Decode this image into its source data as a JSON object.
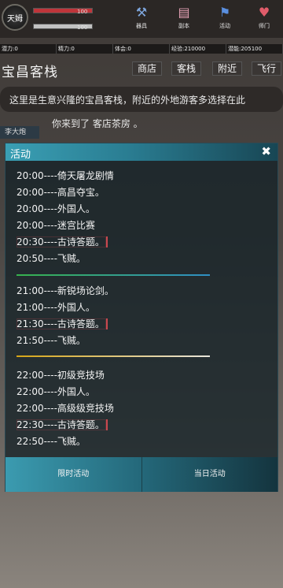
{
  "player": {
    "name": "天姆",
    "hp": "100",
    "mp": "100"
  },
  "nav": [
    {
      "icon": "hammer-anvil-icon",
      "label": "器具"
    },
    {
      "icon": "scroll-icon",
      "label": "副本"
    },
    {
      "icon": "flag-icon",
      "label": "活动"
    },
    {
      "icon": "heart-icon",
      "label": "师门"
    }
  ],
  "stats": [
    "潜力:0",
    "精力:0",
    "体会:0",
    "经验:210000",
    "潜能:205100"
  ],
  "location": {
    "title": "宝昌客栈",
    "buttons": [
      "商店",
      "客栈",
      "附近",
      "飞行"
    ],
    "description": "这里是生意兴隆的宝昌客栈，附近的外地游客多选择在此",
    "arrive": "你来到了 客店茶房 。",
    "npc": "李大炮"
  },
  "modal": {
    "title": "活动",
    "groups": [
      [
        "20:00----倚天屠龙剧情",
        "20:00----高昌夺宝。",
        "20:00----外国人。",
        "20:00----迷宫比赛",
        "20:30----古诗答题。",
        "20:50----飞贼。"
      ],
      [
        "21:00----新锐场论剑。",
        "21:00----外国人。",
        "21:30----古诗答题。",
        "21:50----飞贼。"
      ],
      [
        "22:00----初级竞技场",
        "22:00----外国人。",
        "22:00----高级级竞技场",
        "22:30----古诗答题。",
        "22:50----飞贼。"
      ]
    ],
    "separator_colors": [
      "#37b24d",
      "#2f8fc4",
      "#e8e5dc"
    ],
    "tab_limited": "限时活动",
    "tab_today": "当日活动"
  },
  "colors": {
    "hp": "#c0353a",
    "mp": "#c2c2c2",
    "highlight": "#c8484f"
  }
}
